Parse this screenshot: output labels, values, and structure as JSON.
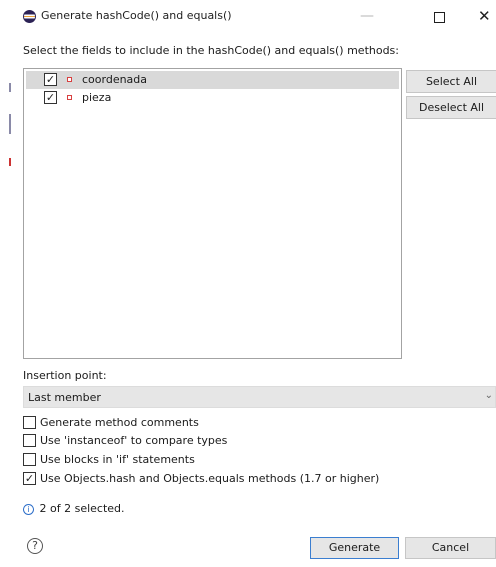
{
  "window": {
    "title": "Generate hashCode() and equals()",
    "minimize_icon": "—",
    "maximize_icon": "square",
    "close_icon": "✕"
  },
  "instructions": "Select the fields to include in the hashCode() and equals() methods:",
  "fields": [
    {
      "name": "coordenada",
      "checked": true,
      "selected": true
    },
    {
      "name": "pieza",
      "checked": true,
      "selected": false
    }
  ],
  "buttons": {
    "select_all": "Select All",
    "deselect_all": "Deselect All",
    "generate": "Generate",
    "cancel": "Cancel",
    "help": "?"
  },
  "insertion_point": {
    "label": "Insertion point:",
    "value": "Last member",
    "arrow": "⌄"
  },
  "options": [
    {
      "label": "Generate method comments",
      "checked": false
    },
    {
      "label": "Use 'instanceof' to compare types",
      "checked": false
    },
    {
      "label": "Use blocks in 'if' statements",
      "checked": false
    },
    {
      "label": "Use Objects.hash and Objects.equals methods (1.7 or higher)",
      "checked": true
    }
  ],
  "status": {
    "icon": "i",
    "text": "2 of 2 selected."
  },
  "check_mark": "✓",
  "colors": {
    "accent": "#3b7ed0",
    "selection": "#d9d9d9",
    "field_icon": "#d84040"
  }
}
